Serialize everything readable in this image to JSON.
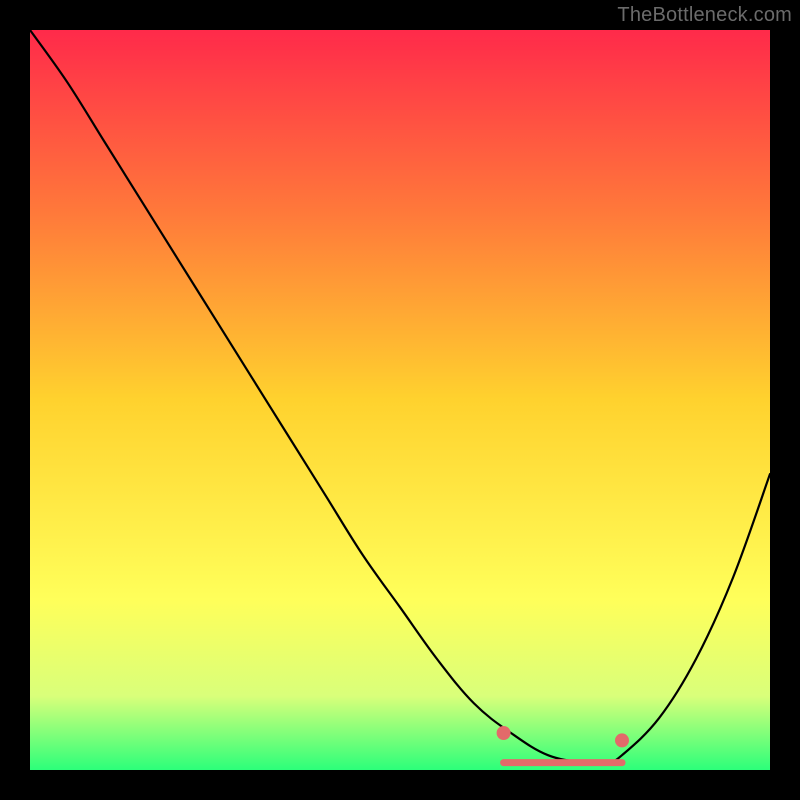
{
  "attribution": "TheBottleneck.com",
  "colors": {
    "background": "#000000",
    "gradient_top": "#ff2a4a",
    "gradient_mid1": "#ff7a3a",
    "gradient_mid2": "#ffd22e",
    "gradient_mid3": "#ffff5a",
    "gradient_mid4": "#d9ff7a",
    "gradient_bottom": "#2cff7a",
    "curve": "#000000",
    "highlight": "#e36a6a"
  },
  "chart_data": {
    "type": "line",
    "title": "",
    "xlabel": "",
    "ylabel": "",
    "xlim": [
      0,
      100
    ],
    "ylim": [
      0,
      100
    ],
    "series": [
      {
        "name": "bottleneck-curve",
        "x": [
          0,
          5,
          10,
          15,
          20,
          25,
          30,
          35,
          40,
          45,
          50,
          55,
          60,
          65,
          70,
          75,
          78,
          80,
          85,
          90,
          95,
          100
        ],
        "values": [
          100,
          93,
          85,
          77,
          69,
          61,
          53,
          45,
          37,
          29,
          22,
          15,
          9,
          5,
          2,
          1,
          1,
          2,
          7,
          15,
          26,
          40
        ]
      }
    ],
    "highlight": {
      "name": "optimal-range",
      "x_start": 64,
      "x_end": 80,
      "y": 1,
      "left_dot_y": 5,
      "right_dot_y": 4
    },
    "grid": false,
    "legend": false
  }
}
